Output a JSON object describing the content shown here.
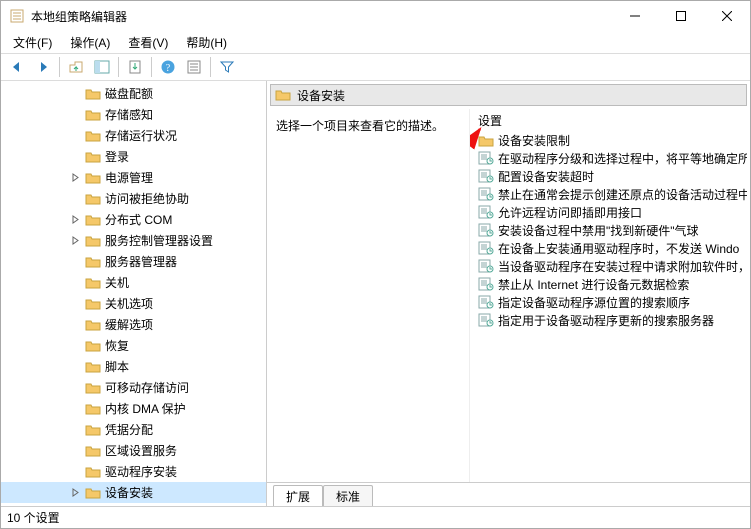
{
  "window": {
    "title": "本地组策略编辑器"
  },
  "menu": {
    "file": "文件(F)",
    "action": "操作(A)",
    "view": "查看(V)",
    "help": "帮助(H)"
  },
  "tree_items": [
    {
      "label": "磁盘配额",
      "exp": ""
    },
    {
      "label": "存储感知",
      "exp": ""
    },
    {
      "label": "存储运行状况",
      "exp": ""
    },
    {
      "label": "登录",
      "exp": ""
    },
    {
      "label": "电源管理",
      "exp": ">"
    },
    {
      "label": "访问被拒绝协助",
      "exp": ""
    },
    {
      "label": "分布式 COM",
      "exp": ">"
    },
    {
      "label": "服务控制管理器设置",
      "exp": ">"
    },
    {
      "label": "服务器管理器",
      "exp": ""
    },
    {
      "label": "关机",
      "exp": ""
    },
    {
      "label": "关机选项",
      "exp": ""
    },
    {
      "label": "缓解选项",
      "exp": ""
    },
    {
      "label": "恢复",
      "exp": ""
    },
    {
      "label": "脚本",
      "exp": ""
    },
    {
      "label": "可移动存储访问",
      "exp": ""
    },
    {
      "label": "内核 DMA 保护",
      "exp": ""
    },
    {
      "label": "凭据分配",
      "exp": ""
    },
    {
      "label": "区域设置服务",
      "exp": ""
    },
    {
      "label": "驱动程序安装",
      "exp": ""
    },
    {
      "label": "设备安装",
      "exp": ">",
      "selected": true
    }
  ],
  "header": {
    "title": "设备安装"
  },
  "desc": "选择一个项目来查看它的描述。",
  "list_header": "设置",
  "items": [
    {
      "label": "设备安装限制",
      "type": "folder"
    },
    {
      "label": "在驱动程序分级和选择过程中，将平等地确定所",
      "type": "policy"
    },
    {
      "label": "配置设备安装超时",
      "type": "policy"
    },
    {
      "label": "禁止在通常会提示创建还原点的设备活动过程中",
      "type": "policy"
    },
    {
      "label": "允许远程访问即插即用接口",
      "type": "policy"
    },
    {
      "label": "安装设备过程中禁用\"找到新硬件\"气球",
      "type": "policy"
    },
    {
      "label": "在设备上安装通用驱动程序时，不发送 Windo",
      "type": "policy"
    },
    {
      "label": "当设备驱动程序在安装过程中请求附加软件时，",
      "type": "policy"
    },
    {
      "label": "禁止从 Internet 进行设备元数据检索",
      "type": "policy"
    },
    {
      "label": "指定设备驱动程序源位置的搜索顺序",
      "type": "policy"
    },
    {
      "label": "指定用于设备驱动程序更新的搜索服务器",
      "type": "policy"
    }
  ],
  "tabs": {
    "extended": "扩展",
    "standard": "标准"
  },
  "status": "10 个设置",
  "colors": {
    "arrow": "#e11"
  }
}
